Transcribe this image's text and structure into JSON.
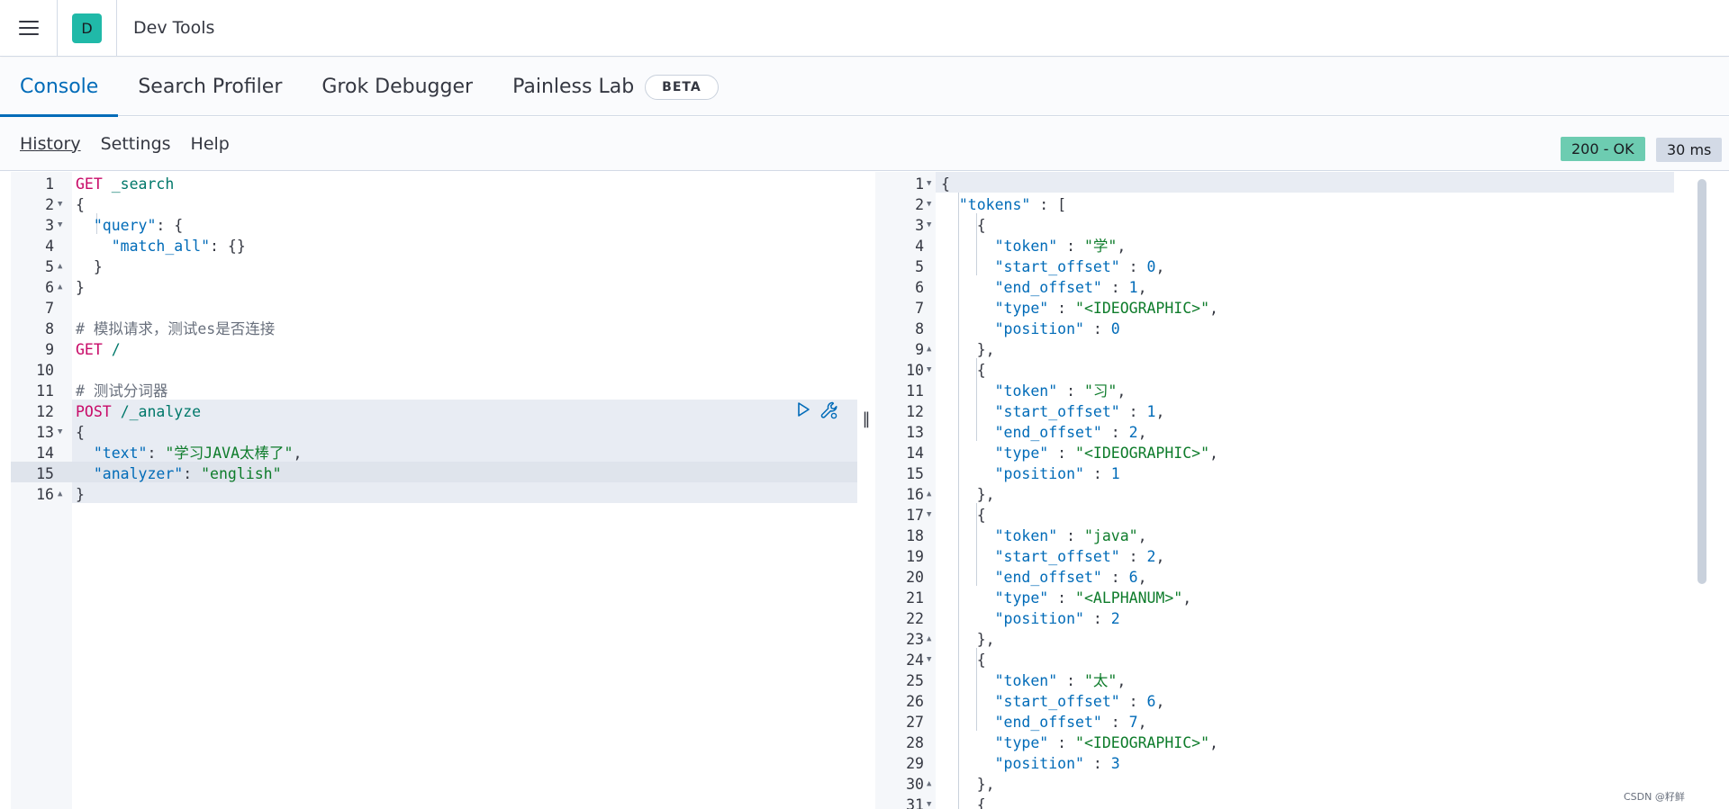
{
  "header": {
    "avatar_letter": "D",
    "title": "Dev Tools"
  },
  "tabs": [
    {
      "label": "Console",
      "active": true
    },
    {
      "label": "Search Profiler",
      "active": false
    },
    {
      "label": "Grok Debugger",
      "active": false
    },
    {
      "label": "Painless Lab",
      "active": false
    }
  ],
  "beta_badge": "BETA",
  "toolbar": {
    "history": "History",
    "settings": "Settings",
    "help": "Help"
  },
  "status": {
    "code": "200 - OK",
    "time": "30 ms"
  },
  "request_lines": [
    "GET _search",
    "{",
    "  \"query\": {",
    "    \"match_all\": {}",
    "  }",
    "}",
    "",
    "# 模拟请求，测试es是否连接",
    "GET /",
    "",
    "# 测试分词器",
    "POST /_analyze",
    "{",
    "  \"text\": \"学习JAVA太棒了\",",
    "  \"analyzer\": \"english\"",
    "}"
  ],
  "response_lines": [
    "{",
    "  \"tokens\" : [",
    "    {",
    "      \"token\" : \"学\",",
    "      \"start_offset\" : 0,",
    "      \"end_offset\" : 1,",
    "      \"type\" : \"<IDEOGRAPHIC>\",",
    "      \"position\" : 0",
    "    },",
    "    {",
    "      \"token\" : \"习\",",
    "      \"start_offset\" : 1,",
    "      \"end_offset\" : 2,",
    "      \"type\" : \"<IDEOGRAPHIC>\",",
    "      \"position\" : 1",
    "    },",
    "    {",
    "      \"token\" : \"java\",",
    "      \"start_offset\" : 2,",
    "      \"end_offset\" : 6,",
    "      \"type\" : \"<ALPHANUM>\",",
    "      \"position\" : 2",
    "    },",
    "    {",
    "      \"token\" : \"太\",",
    "      \"start_offset\" : 6,",
    "      \"end_offset\" : 7,",
    "      \"type\" : \"<IDEOGRAPHIC>\",",
    "      \"position\" : 3",
    "    },",
    "    {"
  ],
  "watermark": "CSDN @籽鲜",
  "colors": {
    "accent": "#006bb8",
    "ok": "#6dccb1",
    "method": "#c80a68",
    "string": "#0e7c2b",
    "avatar": "#20b9a8"
  },
  "icons": {
    "menu": "hamburger-icon",
    "run": "play-icon",
    "wrench": "wrench-icon",
    "splitter": "resize-handle-icon"
  }
}
